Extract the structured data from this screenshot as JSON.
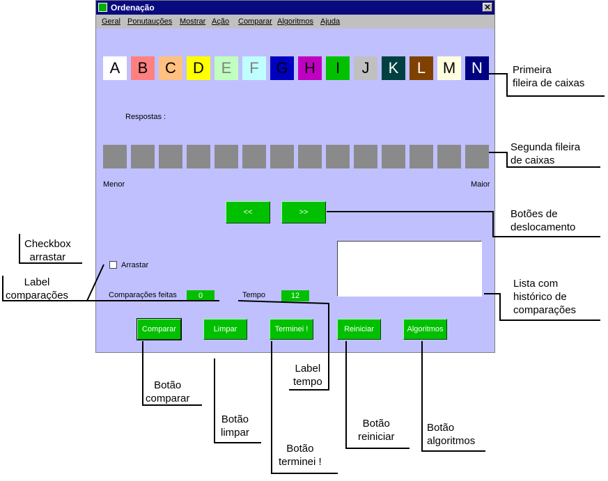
{
  "window": {
    "title": "Ordenação",
    "close": "✕",
    "menu": [
      "Geral",
      "Ponutauções",
      "Mostrar",
      "Ação",
      "Comparar",
      "Algoritmos",
      "Ajuda"
    ]
  },
  "boxes": [
    {
      "letter": "A",
      "bg": "#ffffff",
      "fg": "#000000"
    },
    {
      "letter": "B",
      "bg": "#ff8080",
      "fg": "#000000"
    },
    {
      "letter": "C",
      "bg": "#ffc080",
      "fg": "#000000"
    },
    {
      "letter": "D",
      "bg": "#ffff00",
      "fg": "#000000"
    },
    {
      "letter": "E",
      "bg": "#c0ffc0",
      "fg": "#808080"
    },
    {
      "letter": "F",
      "bg": "#c0ffff",
      "fg": "#808080"
    },
    {
      "letter": "G",
      "bg": "#0000c0",
      "fg": "#000000"
    },
    {
      "letter": "H",
      "bg": "#c000c0",
      "fg": "#000000"
    },
    {
      "letter": "I",
      "bg": "#00c000",
      "fg": "#000000"
    },
    {
      "letter": "J",
      "bg": "#c0c0c0",
      "fg": "#000000"
    },
    {
      "letter": "K",
      "bg": "#004040",
      "fg": "#ffffff"
    },
    {
      "letter": "L",
      "bg": "#804000",
      "fg": "#ffffff"
    },
    {
      "letter": "M",
      "bg": "#ffffe0",
      "fg": "#000000"
    },
    {
      "letter": "N",
      "bg": "#000080",
      "fg": "#ffffff"
    }
  ],
  "labels": {
    "respostas": "Respostas :",
    "menor": "Menor",
    "maior": "Maior",
    "arrastar": "Arrastar",
    "comparacoes": "Comparações feitas",
    "tempo": "Tempo"
  },
  "values": {
    "comparacoes": "0",
    "tempo": "12"
  },
  "buttons": {
    "prev": "<<",
    "next": ">>",
    "comparar": "Comparar",
    "limpar": "Limpar",
    "terminei": "Terminei !",
    "reiniciar": "Reiniciar",
    "algoritmos": "Algoritmos"
  },
  "annotations": {
    "primeira_1": "Primeira",
    "primeira_2": "fileira de caixas",
    "segunda_1": "Segunda fileira",
    "segunda_2": "de caixas",
    "botoes_1": "Botões de",
    "botoes_2": "deslocamento",
    "checkbox_1": "Checkbox",
    "checkbox_2": "arrastar",
    "labelcomp_1": "Label",
    "labelcomp_2": "comparações",
    "lista_1": "Lista com",
    "lista_2": "histórico de",
    "lista_3": "comparações",
    "labeltempo_1": "Label",
    "labeltempo_2": "tempo",
    "bcomparar_1": "Botão",
    "bcomparar_2": "comparar",
    "blimpar_1": "Botão",
    "blimpar_2": "limpar",
    "bterminei_1": "Botão",
    "bterminei_2": "terminei !",
    "breiniciar_1": "Botão",
    "breiniciar_2": "reiniciar",
    "balgoritmos_1": "Botão",
    "balgoritmos_2": "algoritmos"
  }
}
